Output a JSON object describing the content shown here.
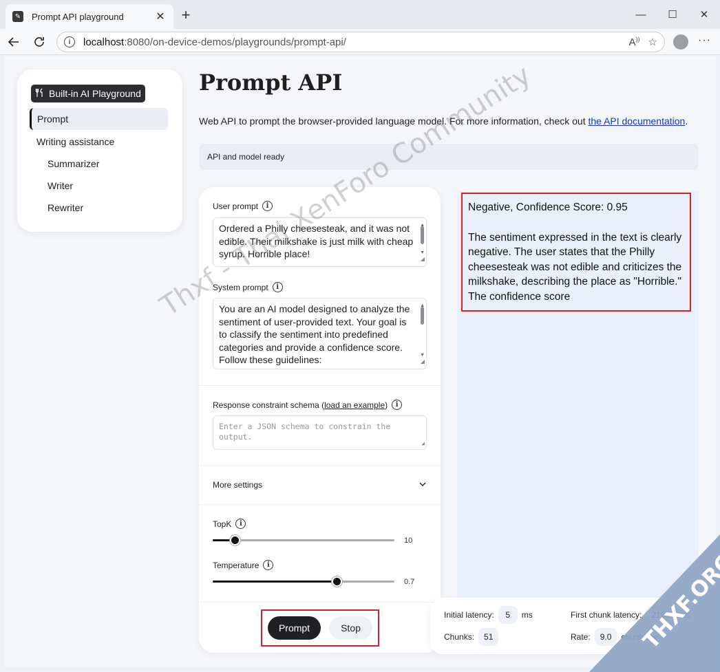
{
  "browser": {
    "tab_title": "Prompt API playground",
    "url_host": "localhost",
    "url_path": ":8080/on-device-demos/playgrounds/prompt-api/"
  },
  "sidebar": {
    "brand": "Built-in AI Playground",
    "items": [
      {
        "label": "Prompt",
        "active": true
      },
      {
        "label": "Writing assistance"
      },
      {
        "label": "Summarizer"
      },
      {
        "label": "Writer"
      },
      {
        "label": "Rewriter"
      }
    ]
  },
  "main": {
    "title": "Prompt API",
    "intro_text": "Web API to prompt the browser-provided language model. For more information, check out ",
    "intro_link": "the API documentation",
    "intro_end": ".",
    "status": "API and model ready"
  },
  "form": {
    "user_prompt_label": "User prompt",
    "user_prompt_value": "Ordered a Philly cheesesteak, and it was not edible. Their milkshake is just milk with cheap syrup. Horrible place!",
    "system_prompt_label": "System prompt",
    "system_prompt_value": "You are an AI model designed to analyze the sentiment of user-provided text. Your goal is to classify the sentiment into predefined categories and provide a confidence score. Follow these guidelines:",
    "schema_label": "Response constraint schema (",
    "schema_link": "load an example",
    "schema_label_end": ")",
    "schema_placeholder": "Enter a JSON schema to constrain the output.",
    "more_settings": "More settings",
    "topk_label": "TopK",
    "topk_value": "10",
    "topk_fraction": 0.12,
    "temperature_label": "Temperature",
    "temperature_value": "0.7",
    "temperature_fraction": 0.68,
    "prompt_button": "Prompt",
    "stop_button": "Stop"
  },
  "response": {
    "line1": "Negative, Confidence Score: 0.95",
    "line2": "The sentiment expressed in the text is clearly negative. The user states that the Philly cheesesteak was not edible and criticizes the milkshake, describing the place as \"Horrible.\" The confidence score"
  },
  "stats": {
    "initial_latency_label": "Initial latency:",
    "initial_latency_value": "5",
    "initial_latency_unit": "ms",
    "first_chunk_label": "First chunk latency:",
    "first_chunk_value": "2163",
    "first_chunk_unit": "ms",
    "chunks_label": "Chunks:",
    "chunks_value": "51",
    "rate_label": "Rate:",
    "rate_value": "9.0",
    "rate_unit": "chunk/sec"
  },
  "overlay": {
    "watermark": "Thxf - Thai XenForo Community",
    "badge": "THXF.ORG"
  }
}
